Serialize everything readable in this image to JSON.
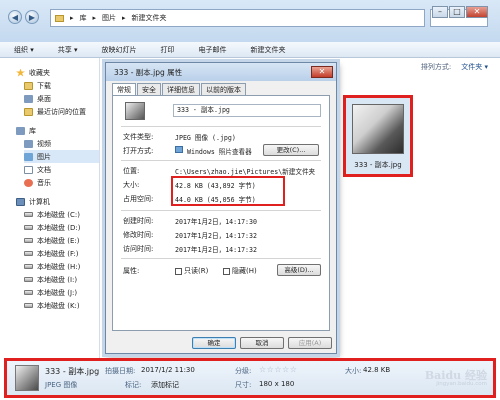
{
  "explorer": {
    "breadcrumb": [
      "库",
      "图片",
      "新建文件夹"
    ],
    "toolbar": [
      "组织 ▾",
      "共享 ▾",
      "放映幻灯片",
      "打印",
      "电子邮件",
      "新建文件夹"
    ],
    "view": {
      "arrange_label": "排列方式:",
      "arrange_value": "文件夹 ▾"
    },
    "sidebar": {
      "favorites_title": "收藏夹",
      "favorites": [
        "下载",
        "桌面",
        "最近访问的位置"
      ],
      "library_title": "库",
      "libraries": [
        "视频",
        "图片",
        "文档",
        "音乐"
      ],
      "computer_title": "计算机",
      "drives": [
        "本地磁盘 (C:)",
        "本地磁盘 (D:)",
        "本地磁盘 (E:)",
        "本地磁盘 (F:)",
        "本地磁盘 (H:)",
        "本地磁盘 (I:)",
        "本地磁盘 (J:)",
        "本地磁盘 (K:)"
      ]
    },
    "file_thumb_name": "333 - 副本.jpg"
  },
  "dialog": {
    "title": "333 - 副本.jpg 属性",
    "tabs": [
      "常规",
      "安全",
      "详细信息",
      "以前的版本"
    ],
    "active_tab": "常规",
    "filename": "333 - 副本.jpg",
    "file_type_label": "文件类型:",
    "file_type_value": "JPEG 图像 (.jpg)",
    "open_with_label": "打开方式:",
    "open_with_value": "Windows 照片查看器",
    "change_button": "更改(C)...",
    "location_label": "位置:",
    "location_value": "C:\\Users\\zhao.jie\\Pictures\\新建文件夹",
    "size_label": "大小:",
    "size_value": "42.8 KB (43,892 字节)",
    "disk_size_label": "占用空间:",
    "disk_size_value": "44.0 KB (45,056 字节)",
    "created_label": "创建时间:",
    "created_value": "2017年1月2日，14:17:30",
    "modified_label": "修改时间:",
    "modified_value": "2017年1月2日，14:17:32",
    "accessed_label": "访问时间:",
    "accessed_value": "2017年1月2日，14:17:32",
    "attr_label": "属性:",
    "readonly_label": "只读(R)",
    "hidden_label": "隐藏(H)",
    "advanced_button": "高级(D)...",
    "ok_button": "确定",
    "cancel_button": "取消",
    "apply_button": "应用(A)"
  },
  "status": {
    "name": "333 - 副本.jpg",
    "type": "JPEG 图像",
    "date_label": "拍摄日期:",
    "date_value": "2017/1/2 11:30",
    "tag_label": "标记:",
    "tag_value": "添加标记",
    "rating_label": "分级:",
    "rating_stars": "☆☆☆☆☆",
    "size_label": "大小:",
    "size_value": "42.8 KB",
    "dim_label": "尺寸:",
    "dim_value": "180 x 180"
  },
  "watermark": {
    "brand": "Baidu 经验",
    "sub": "jingyan.baidu.com"
  }
}
